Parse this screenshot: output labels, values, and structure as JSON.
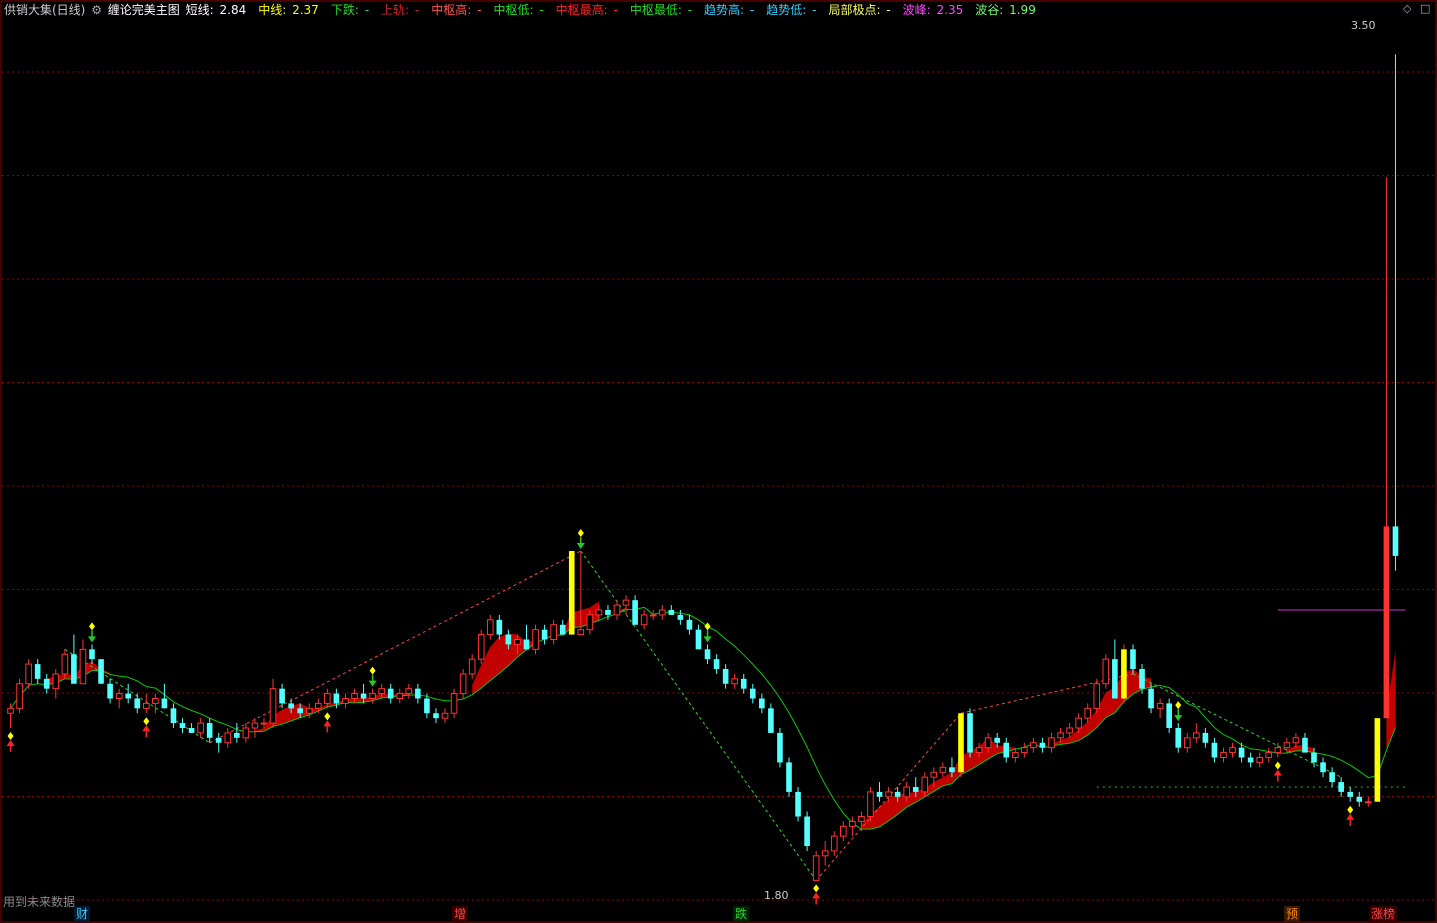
{
  "header": {
    "title": "供销大集(日线)",
    "indicator_name": "缠论完美主图",
    "items": [
      {
        "label": "短线:",
        "value": "2.84",
        "label_color": "#ffffff",
        "value_color": "#ffffff"
      },
      {
        "label": "中线:",
        "value": "2.37",
        "label_color": "#ffff00",
        "value_color": "#ffff00"
      },
      {
        "label": "下跌:",
        "value": "-",
        "label_color": "#22dd22",
        "value_color": "#22dd22"
      },
      {
        "label": "上轨:",
        "value": "-",
        "label_color": "#cc2222",
        "value_color": "#cc2222"
      },
      {
        "label": "中枢高:",
        "value": "-",
        "label_color": "#ff5555",
        "value_color": "#ff5555"
      },
      {
        "label": "中枢低:",
        "value": "-",
        "label_color": "#22dd22",
        "value_color": "#22dd22"
      },
      {
        "label": "中枢最高:",
        "value": "-",
        "label_color": "#ff2222",
        "value_color": "#ff2222"
      },
      {
        "label": "中枢最低:",
        "value": "-",
        "label_color": "#22dd22",
        "value_color": "#22dd22"
      },
      {
        "label": "趋势高:",
        "value": "-",
        "label_color": "#33ccff",
        "value_color": "#33ccff"
      },
      {
        "label": "趋势低:",
        "value": "-",
        "label_color": "#33ccff",
        "value_color": "#33ccff"
      },
      {
        "label": "局部极点:",
        "value": "-",
        "label_color": "#ffff66",
        "value_color": "#ffff66"
      },
      {
        "label": "波峰:",
        "value": "2.35",
        "label_color": "#ff44ff",
        "value_color": "#ff44ff"
      },
      {
        "label": "波谷:",
        "value": "1.99",
        "label_color": "#66ff66",
        "value_color": "#66ff66"
      }
    ]
  },
  "footer_note": "用到未来数据",
  "event_labels": [
    {
      "text": "财",
      "color": "#33ccff",
      "bg": "#001a33"
    },
    {
      "text": "增",
      "color": "#ff4444",
      "bg": "#330000"
    },
    {
      "text": "跌",
      "color": "#22dd22",
      "bg": "#002200"
    },
    {
      "text": "预",
      "color": "#ff8800",
      "bg": "#331a00"
    },
    {
      "text": "涨榜",
      "color": "#ff4444",
      "bg": "#330000"
    }
  ],
  "colors": {
    "up": "#ff3232",
    "down": "#54ffff",
    "highlight": "#ffff00",
    "ribbon": "#cc0000",
    "midline": "#00cc00",
    "peak_line": "#cc33cc",
    "trough_line": "#22bb22",
    "grid": "#8b0000"
  },
  "icons": {
    "settings": "gear-icon",
    "window": "diamond-icon"
  },
  "chart_data": {
    "type": "candlestick",
    "ylim": [
      1.75,
      3.55
    ],
    "price_labels": {
      "max": "3.50",
      "min": "1.80"
    },
    "peak_level": 2.35,
    "trough_level": 1.99,
    "candles": [
      [
        2.14,
        2.16,
        2.11,
        2.15
      ],
      [
        2.15,
        2.21,
        2.14,
        2.2
      ],
      [
        2.2,
        2.25,
        2.19,
        2.24
      ],
      [
        2.24,
        2.25,
        2.2,
        2.21
      ],
      [
        2.21,
        2.22,
        2.18,
        2.19
      ],
      [
        2.19,
        2.23,
        2.17,
        2.22
      ],
      [
        2.22,
        2.27,
        2.21,
        2.26
      ],
      [
        2.26,
        2.3,
        2.2,
        2.2
      ],
      [
        2.2,
        2.29,
        2.2,
        2.27
      ],
      [
        2.27,
        2.28,
        2.24,
        2.25
      ],
      [
        2.25,
        2.25,
        2.2,
        2.2
      ],
      [
        2.2,
        2.21,
        2.16,
        2.17
      ],
      [
        2.17,
        2.19,
        2.15,
        2.18
      ],
      [
        2.18,
        2.2,
        2.16,
        2.17
      ],
      [
        2.17,
        2.18,
        2.14,
        2.15
      ],
      [
        2.15,
        2.18,
        2.14,
        2.16
      ],
      [
        2.16,
        2.18,
        2.14,
        2.17
      ],
      [
        2.17,
        2.2,
        2.15,
        2.15
      ],
      [
        2.15,
        2.16,
        2.11,
        2.12
      ],
      [
        2.12,
        2.13,
        2.1,
        2.11
      ],
      [
        2.11,
        2.12,
        2.1,
        2.1
      ],
      [
        2.1,
        2.13,
        2.09,
        2.12
      ],
      [
        2.12,
        2.13,
        2.08,
        2.09
      ],
      [
        2.09,
        2.1,
        2.06,
        2.08
      ],
      [
        2.08,
        2.11,
        2.07,
        2.1
      ],
      [
        2.1,
        2.12,
        2.08,
        2.09
      ],
      [
        2.09,
        2.12,
        2.08,
        2.11
      ],
      [
        2.11,
        2.13,
        2.09,
        2.12
      ],
      [
        2.12,
        2.13,
        2.11,
        2.12
      ],
      [
        2.12,
        2.21,
        2.11,
        2.19
      ],
      [
        2.19,
        2.2,
        2.15,
        2.16
      ],
      [
        2.16,
        2.17,
        2.14,
        2.15
      ],
      [
        2.15,
        2.16,
        2.13,
        2.14
      ],
      [
        2.14,
        2.16,
        2.13,
        2.15
      ],
      [
        2.15,
        2.17,
        2.14,
        2.16
      ],
      [
        2.16,
        2.19,
        2.15,
        2.18
      ],
      [
        2.18,
        2.19,
        2.15,
        2.16
      ],
      [
        2.16,
        2.18,
        2.15,
        2.17
      ],
      [
        2.17,
        2.19,
        2.16,
        2.18
      ],
      [
        2.18,
        2.2,
        2.16,
        2.17
      ],
      [
        2.17,
        2.19,
        2.16,
        2.18
      ],
      [
        2.18,
        2.2,
        2.17,
        2.19
      ],
      [
        2.19,
        2.2,
        2.16,
        2.17
      ],
      [
        2.17,
        2.19,
        2.16,
        2.18
      ],
      [
        2.18,
        2.2,
        2.17,
        2.19
      ],
      [
        2.19,
        2.2,
        2.16,
        2.17
      ],
      [
        2.17,
        2.18,
        2.13,
        2.14
      ],
      [
        2.14,
        2.15,
        2.12,
        2.13
      ],
      [
        2.13,
        2.15,
        2.12,
        2.14
      ],
      [
        2.14,
        2.19,
        2.13,
        2.18
      ],
      [
        2.18,
        2.23,
        2.17,
        2.22
      ],
      [
        2.22,
        2.26,
        2.21,
        2.25
      ],
      [
        2.25,
        2.31,
        2.24,
        2.3
      ],
      [
        2.3,
        2.34,
        2.29,
        2.33
      ],
      [
        2.33,
        2.34,
        2.29,
        2.3
      ],
      [
        2.3,
        2.31,
        2.27,
        2.28
      ],
      [
        2.28,
        2.3,
        2.26,
        2.29
      ],
      [
        2.29,
        2.32,
        2.27,
        2.27
      ],
      [
        2.27,
        2.32,
        2.26,
        2.31
      ],
      [
        2.31,
        2.32,
        2.28,
        2.29
      ],
      [
        2.29,
        2.33,
        2.28,
        2.32
      ],
      [
        2.32,
        2.33,
        2.3,
        2.3
      ],
      [
        2.3,
        2.47,
        2.3,
        2.47
      ],
      [
        2.3,
        2.47,
        2.3,
        2.31
      ],
      [
        2.31,
        2.35,
        2.3,
        2.34
      ],
      [
        2.34,
        2.36,
        2.33,
        2.35
      ],
      [
        2.35,
        2.36,
        2.33,
        2.34
      ],
      [
        2.34,
        2.37,
        2.33,
        2.36
      ],
      [
        2.36,
        2.38,
        2.34,
        2.37
      ],
      [
        2.37,
        2.38,
        2.32,
        2.32
      ],
      [
        2.32,
        2.35,
        2.31,
        2.34
      ],
      [
        2.34,
        2.35,
        2.33,
        2.34
      ],
      [
        2.34,
        2.36,
        2.33,
        2.35
      ],
      [
        2.35,
        2.36,
        2.34,
        2.34
      ],
      [
        2.34,
        2.35,
        2.32,
        2.33
      ],
      [
        2.33,
        2.34,
        2.3,
        2.31
      ],
      [
        2.31,
        2.32,
        2.27,
        2.27
      ],
      [
        2.27,
        2.28,
        2.24,
        2.25
      ],
      [
        2.25,
        2.26,
        2.22,
        2.23
      ],
      [
        2.23,
        2.24,
        2.19,
        2.2
      ],
      [
        2.2,
        2.22,
        2.19,
        2.21
      ],
      [
        2.21,
        2.22,
        2.18,
        2.19
      ],
      [
        2.19,
        2.2,
        2.16,
        2.17
      ],
      [
        2.17,
        2.18,
        2.14,
        2.15
      ],
      [
        2.15,
        2.16,
        2.1,
        2.1
      ],
      [
        2.1,
        2.11,
        2.03,
        2.04
      ],
      [
        2.04,
        2.05,
        1.97,
        1.98
      ],
      [
        1.98,
        1.99,
        1.92,
        1.93
      ],
      [
        1.93,
        1.94,
        1.86,
        1.87
      ],
      [
        1.8,
        1.86,
        1.8,
        1.85
      ],
      [
        1.85,
        1.88,
        1.83,
        1.86
      ],
      [
        1.86,
        1.9,
        1.85,
        1.89
      ],
      [
        1.89,
        1.92,
        1.88,
        1.91
      ],
      [
        1.91,
        1.93,
        1.89,
        1.92
      ],
      [
        1.92,
        1.94,
        1.9,
        1.93
      ],
      [
        1.93,
        1.99,
        1.92,
        1.98
      ],
      [
        1.98,
        2.0,
        1.96,
        1.97
      ],
      [
        1.97,
        1.99,
        1.96,
        1.98
      ],
      [
        1.98,
        1.99,
        1.96,
        1.97
      ],
      [
        1.97,
        2.0,
        1.96,
        1.99
      ],
      [
        1.99,
        2.01,
        1.97,
        1.98
      ],
      [
        1.98,
        2.02,
        1.97,
        2.01
      ],
      [
        2.01,
        2.03,
        1.99,
        2.02
      ],
      [
        2.02,
        2.04,
        2.01,
        2.03
      ],
      [
        2.03,
        2.05,
        2.01,
        2.02
      ],
      [
        2.02,
        2.14,
        2.01,
        2.14
      ],
      [
        2.14,
        2.15,
        2.05,
        2.06
      ],
      [
        2.06,
        2.08,
        2.05,
        2.07
      ],
      [
        2.07,
        2.1,
        2.06,
        2.09
      ],
      [
        2.09,
        2.1,
        2.07,
        2.08
      ],
      [
        2.08,
        2.09,
        2.04,
        2.05
      ],
      [
        2.05,
        2.07,
        2.04,
        2.06
      ],
      [
        2.06,
        2.08,
        2.05,
        2.07
      ],
      [
        2.07,
        2.09,
        2.06,
        2.08
      ],
      [
        2.08,
        2.09,
        2.06,
        2.07
      ],
      [
        2.07,
        2.1,
        2.06,
        2.09
      ],
      [
        2.09,
        2.11,
        2.08,
        2.1
      ],
      [
        2.1,
        2.12,
        2.09,
        2.11
      ],
      [
        2.11,
        2.14,
        2.1,
        2.13
      ],
      [
        2.13,
        2.16,
        2.12,
        2.15
      ],
      [
        2.15,
        2.21,
        2.14,
        2.2
      ],
      [
        2.2,
        2.26,
        2.19,
        2.25
      ],
      [
        2.25,
        2.29,
        2.17,
        2.17
      ],
      [
        2.17,
        2.28,
        2.16,
        2.27
      ],
      [
        2.27,
        2.28,
        2.22,
        2.23
      ],
      [
        2.23,
        2.24,
        2.18,
        2.19
      ],
      [
        2.19,
        2.2,
        2.14,
        2.15
      ],
      [
        2.15,
        2.17,
        2.13,
        2.16
      ],
      [
        2.16,
        2.17,
        2.1,
        2.11
      ],
      [
        2.11,
        2.12,
        2.06,
        2.07
      ],
      [
        2.07,
        2.1,
        2.06,
        2.09
      ],
      [
        2.09,
        2.12,
        2.08,
        2.1
      ],
      [
        2.1,
        2.11,
        2.07,
        2.08
      ],
      [
        2.08,
        2.09,
        2.04,
        2.05
      ],
      [
        2.05,
        2.07,
        2.04,
        2.06
      ],
      [
        2.06,
        2.08,
        2.05,
        2.07
      ],
      [
        2.07,
        2.08,
        2.04,
        2.05
      ],
      [
        2.05,
        2.06,
        2.03,
        2.04
      ],
      [
        2.04,
        2.06,
        2.03,
        2.05
      ],
      [
        2.05,
        2.07,
        2.04,
        2.06
      ],
      [
        2.06,
        2.08,
        2.05,
        2.07
      ],
      [
        2.07,
        2.09,
        2.06,
        2.08
      ],
      [
        2.08,
        2.1,
        2.07,
        2.09
      ],
      [
        2.09,
        2.1,
        2.06,
        2.06
      ],
      [
        2.06,
        2.07,
        2.03,
        2.04
      ],
      [
        2.04,
        2.05,
        2.01,
        2.02
      ],
      [
        2.02,
        2.03,
        1.99,
        2.0
      ],
      [
        2.0,
        2.01,
        1.97,
        1.98
      ],
      [
        1.98,
        1.99,
        1.96,
        1.97
      ],
      [
        1.97,
        1.98,
        1.95,
        1.96
      ],
      [
        1.96,
        1.97,
        1.95,
        1.96
      ],
      [
        1.96,
        2.13,
        1.96,
        2.13
      ],
      [
        2.13,
        3.23,
        2.13,
        2.52
      ],
      [
        2.52,
        3.48,
        2.43,
        2.46
      ]
    ]
  }
}
